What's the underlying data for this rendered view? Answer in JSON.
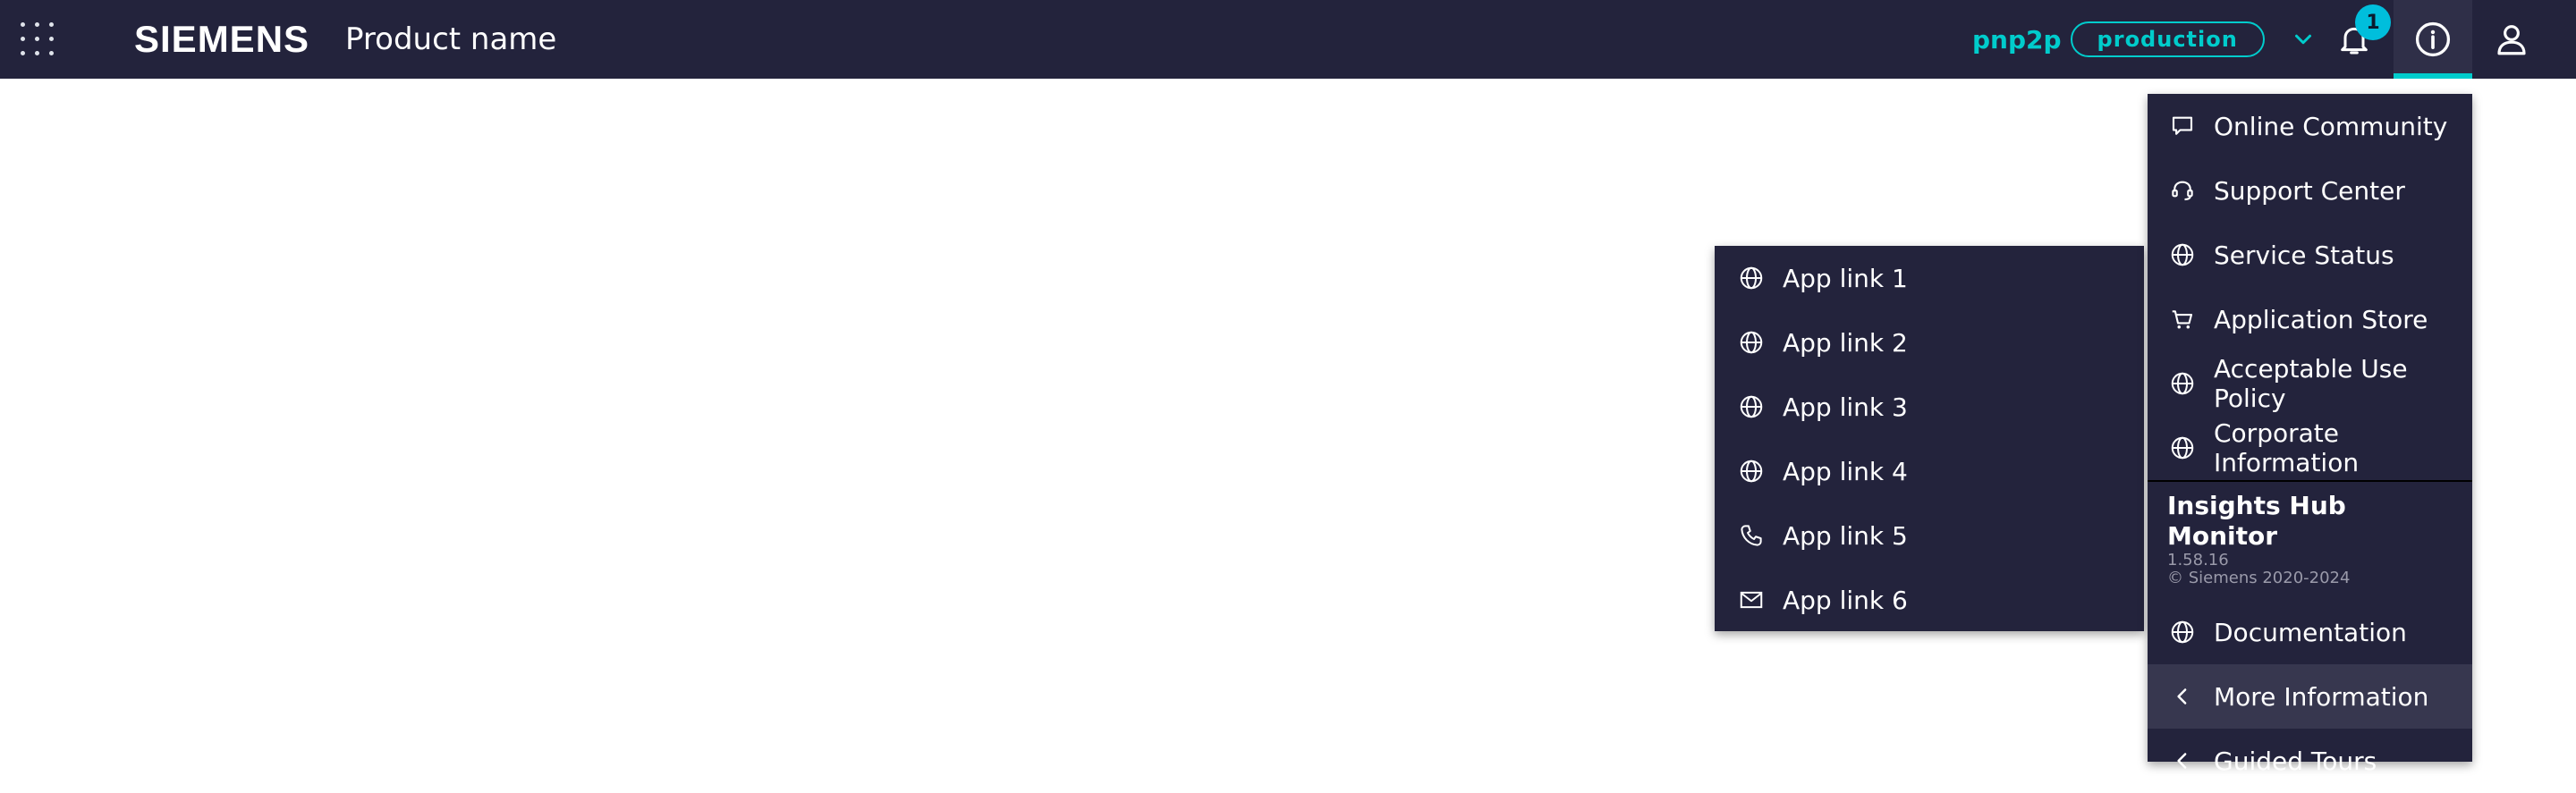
{
  "header": {
    "brand": "SIEMENS",
    "product_name": "Product name",
    "environment_name": "pnp2p",
    "environment_tag": "production",
    "notification_count": "1"
  },
  "help_menu": {
    "items": [
      {
        "label": "Online Community",
        "icon": "chat-icon"
      },
      {
        "label": "Support Center",
        "icon": "headset-icon"
      },
      {
        "label": "Service Status",
        "icon": "globe-icon"
      },
      {
        "label": "Application Store",
        "icon": "cart-icon"
      },
      {
        "label": "Acceptable Use Policy",
        "icon": "globe-icon"
      },
      {
        "label": "Corporate Information",
        "icon": "globe-icon"
      }
    ],
    "about": {
      "title": "Insights Hub Monitor",
      "version": "1.58.16",
      "copyright": "© Siemens 2020-2024"
    },
    "app_items": [
      {
        "label": "Documentation",
        "icon": "globe-icon"
      },
      {
        "label": "More Information",
        "icon": "chevron-left-icon"
      },
      {
        "label": "Guided Tours",
        "icon": "chevron-left-icon"
      }
    ]
  },
  "submenu": {
    "items": [
      {
        "label": "App link 1",
        "icon": "globe-icon"
      },
      {
        "label": "App link 2",
        "icon": "globe-icon"
      },
      {
        "label": "App link 3",
        "icon": "globe-icon"
      },
      {
        "label": "App link 4",
        "icon": "globe-icon"
      },
      {
        "label": "App link 5",
        "icon": "phone-icon"
      },
      {
        "label": "App link 6",
        "icon": "mail-icon"
      }
    ]
  },
  "colors": {
    "header_bg": "#23233c",
    "menu_bg": "#23233c",
    "accent": "#00cccc",
    "badge": "#00bedc"
  }
}
